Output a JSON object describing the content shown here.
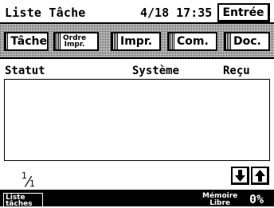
{
  "header": {
    "title": "Liste Tâche",
    "datetime": "4/18 17:35",
    "entree_label": "Entrée"
  },
  "tabs": [
    {
      "label": "Tâche"
    },
    {
      "label_line1": "Ordre",
      "label_line2": "Impr."
    },
    {
      "label": "Impr."
    },
    {
      "label": "Com."
    },
    {
      "label": "Doc."
    }
  ],
  "columns": [
    "Statut",
    "Système",
    "Reçu"
  ],
  "rows": [],
  "pager": {
    "current": "1",
    "total": "1"
  },
  "icons": {
    "down": "arrow-down-icon",
    "up": "arrow-up-icon"
  },
  "status": {
    "left_line1": "Liste",
    "left_line2": "tâches",
    "memory_line1": "Mémoire",
    "memory_line2": "Libre",
    "memory_value": "0%"
  }
}
